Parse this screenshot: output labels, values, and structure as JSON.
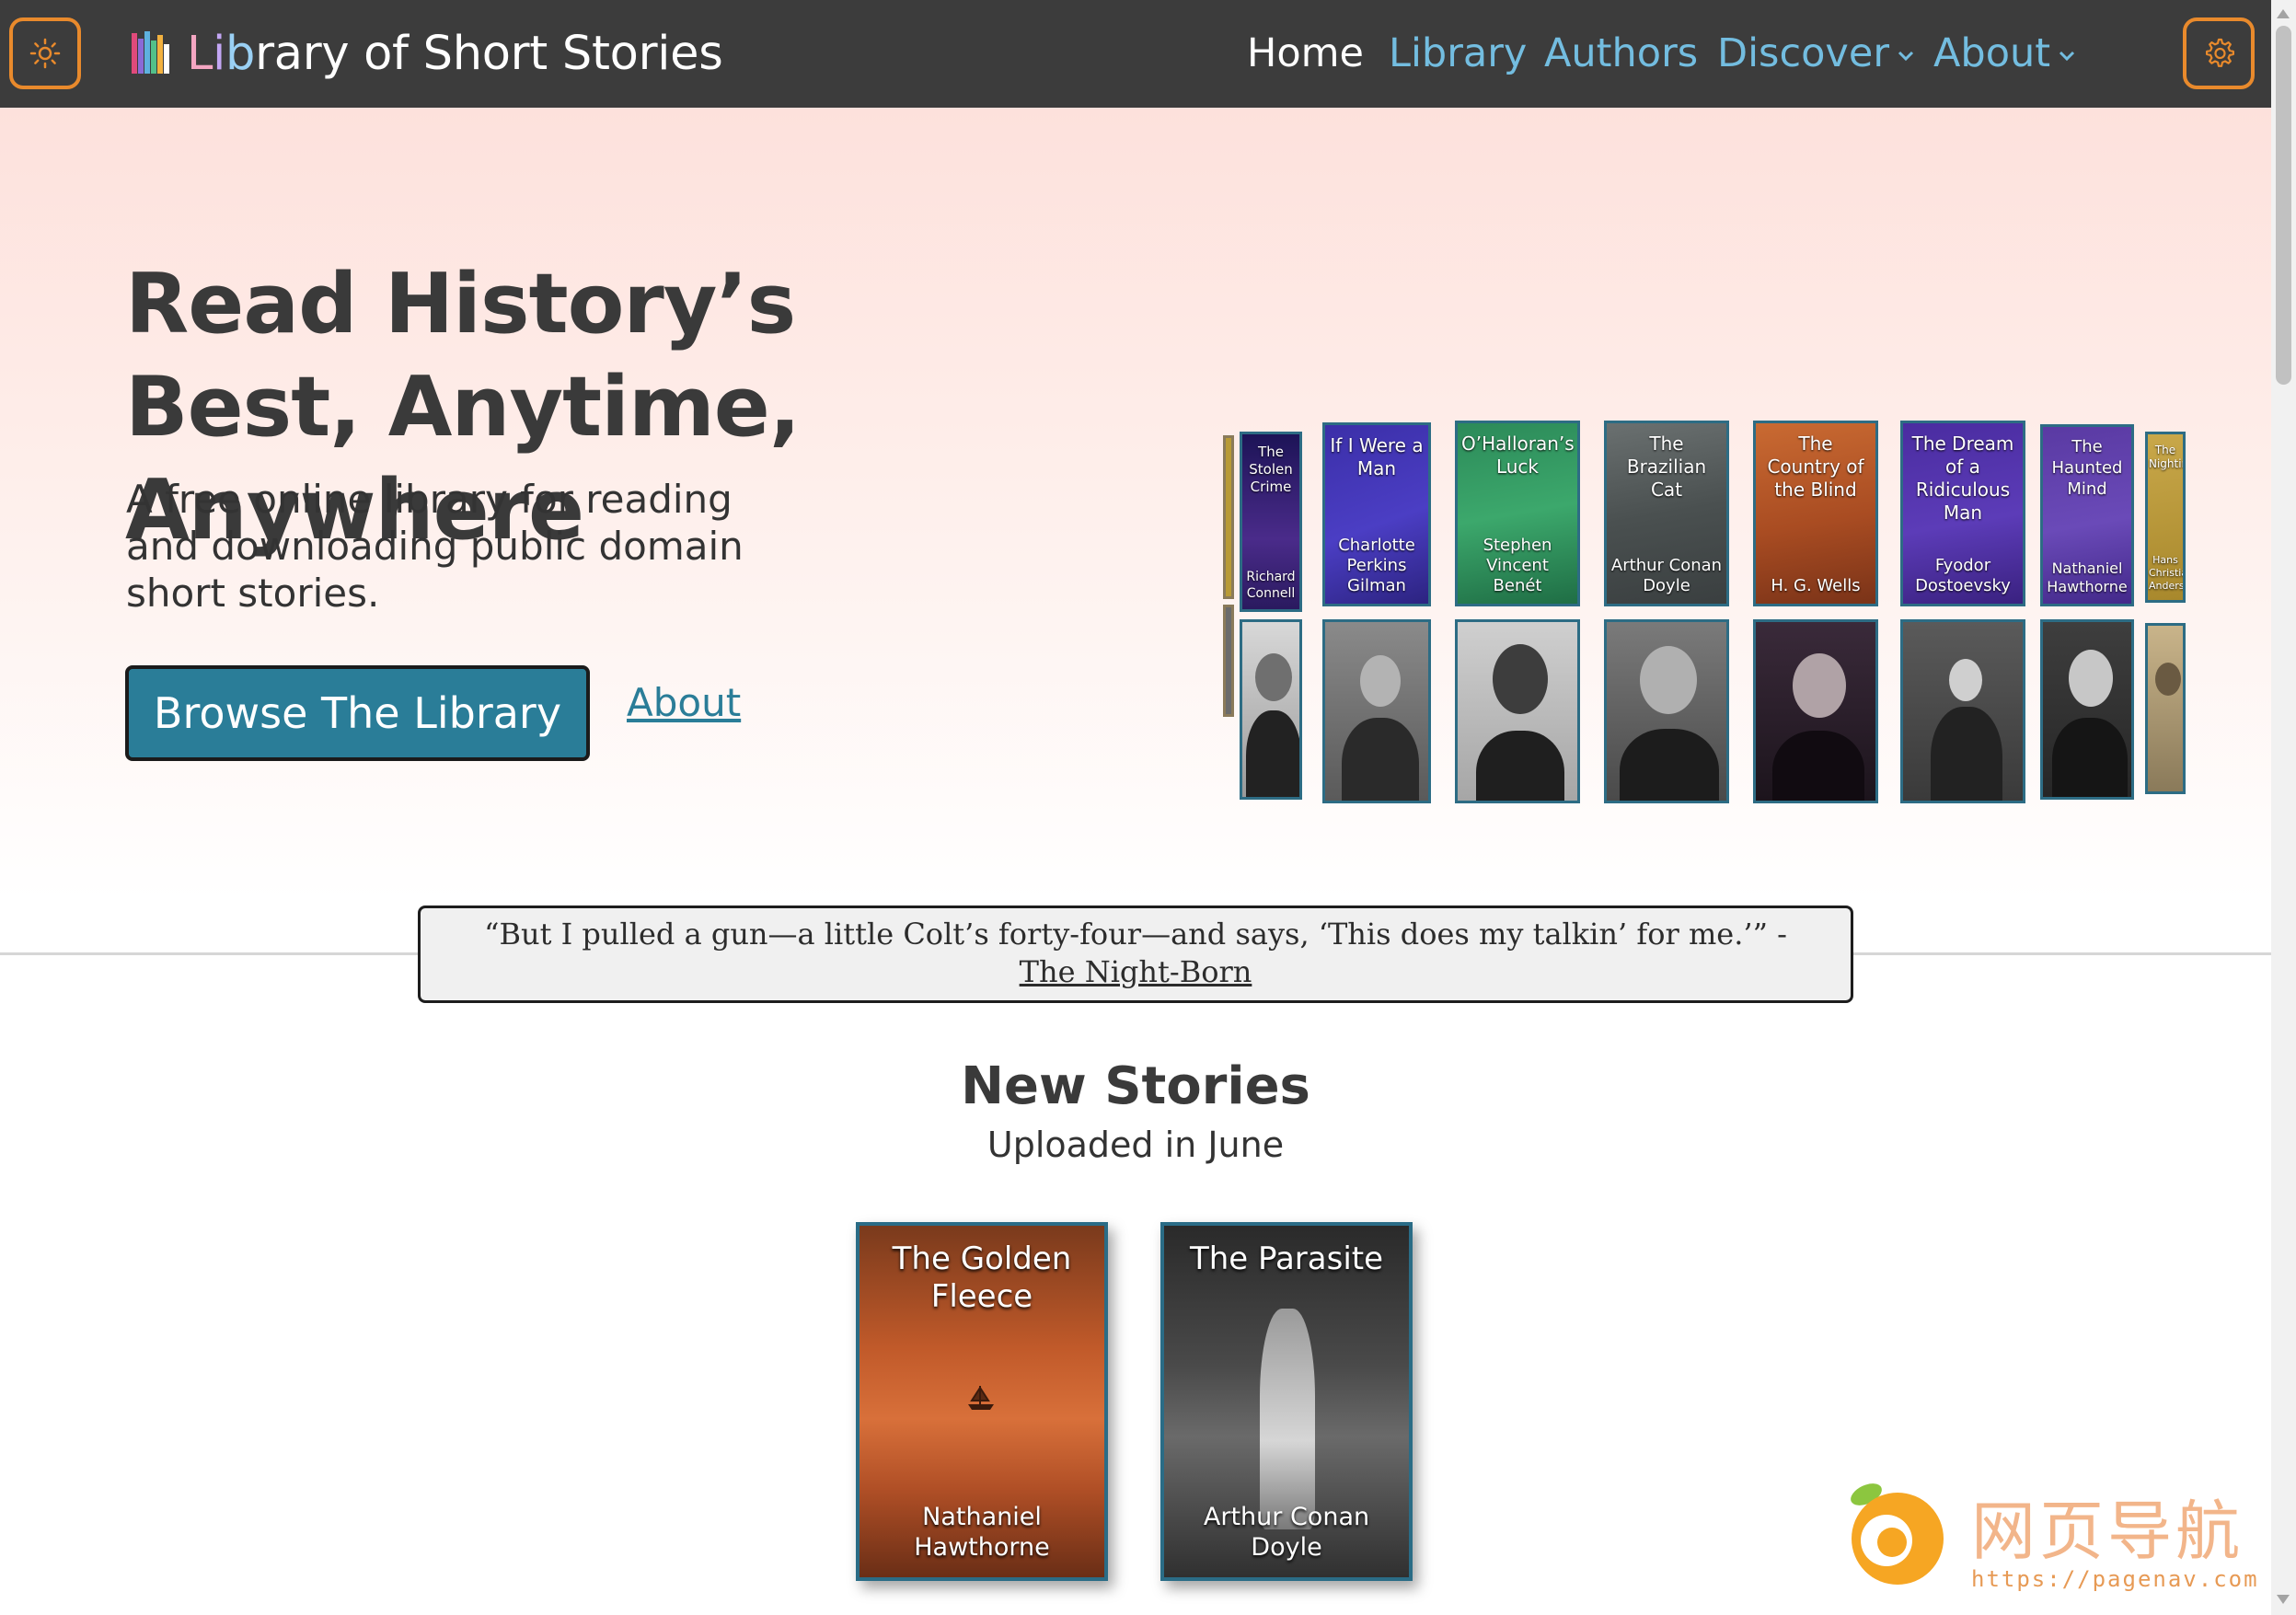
{
  "nav": {
    "theme_toggle_icon": "sun-icon",
    "brand_title": "Library of Short Stories",
    "brand_colors": [
      "#f4a6c2",
      "#c3a6f4",
      "#9ad0f4",
      "#ffffff"
    ],
    "links": [
      {
        "label": "Home",
        "active": true
      },
      {
        "label": "Library",
        "active": false
      },
      {
        "label": "Authors",
        "active": false
      },
      {
        "label": "Discover",
        "active": false,
        "dropdown": true
      },
      {
        "label": "About",
        "active": false,
        "dropdown": true
      }
    ],
    "settings_icon": "gear-icon"
  },
  "hero": {
    "title": "Read History’s Best, Anytime, Anywhere",
    "subtitle": "A free online library for reading and downloading public domain short stories.",
    "browse_button": "Browse The Library",
    "about_link": "About"
  },
  "carousel": {
    "covers": [
      {
        "title": "The Stolen Crime",
        "author": "Richard Connell",
        "color": "#43267a"
      },
      {
        "title": "If I Were a Man",
        "author": "Charlotte Perkins Gilman",
        "color": "#3b2fa8"
      },
      {
        "title": "O’Halloran’s Luck",
        "author": "Stephen Vincent Benét",
        "color": "#2c8a59"
      },
      {
        "title": "The Brazilian Cat",
        "author": "Arthur Conan Doyle",
        "color": "#5d6464"
      },
      {
        "title": "The Country of the Blind",
        "author": "H. G. Wells",
        "color": "#b3562b"
      },
      {
        "title": "The Dream of a Ridiculous Man",
        "author": "Fyodor Dostoevsky",
        "color": "#4a2ca0"
      },
      {
        "title": "The Haunted Mind",
        "author": "Nathaniel Hawthorne",
        "color": "#5a3aa3"
      },
      {
        "title": "The Nightingale",
        "author": "Hans Christian Andersen",
        "color": "#b89a36"
      }
    ]
  },
  "quote": {
    "text": "“But I pulled a gun—a little Colt’s forty-four—and says, ‘This does my talkin’ for me.’” - ",
    "source_link": "The Night-Born"
  },
  "new_stories": {
    "title": "New Stories",
    "subtitle": "Uploaded in June",
    "books": [
      {
        "title": "The Golden Fleece",
        "author": "Nathaniel Hawthorne"
      },
      {
        "title": "The Parasite",
        "author": "Arthur Conan Doyle"
      }
    ]
  },
  "watermark": {
    "text": "网页导航",
    "url": "https://pagenav.com"
  }
}
